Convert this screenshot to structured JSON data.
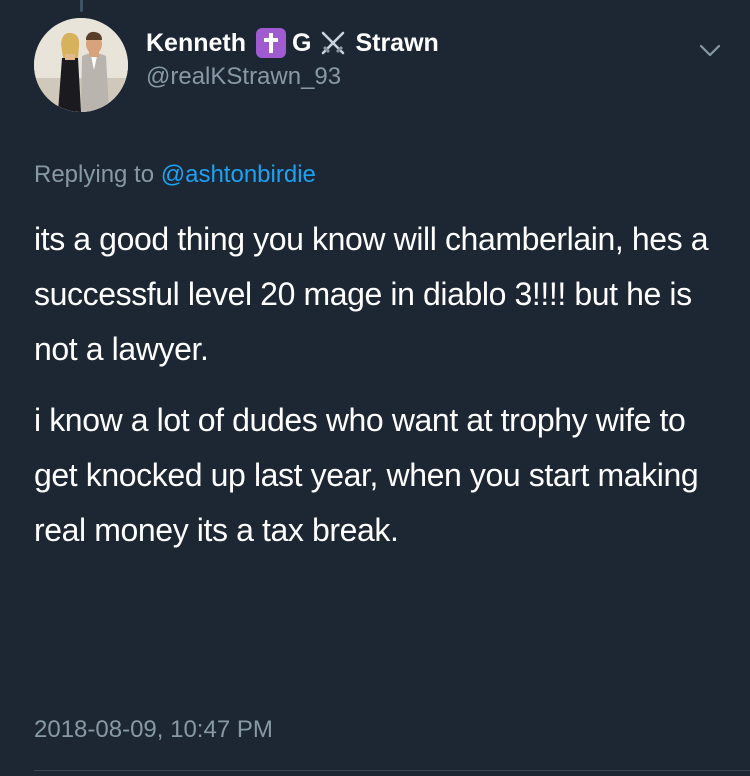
{
  "author": {
    "first_name": "Kenneth",
    "middle": "G",
    "last_name": "Strawn",
    "handle": "@realKStrawn_93"
  },
  "reply": {
    "prefix": "Replying to",
    "mention": "@ashtonbirdie"
  },
  "tweet": {
    "paragraphs": [
      "its a good thing you know will chamberlain, hes a successful level 20 mage in diablo 3!!!! but he is not a lawyer.",
      "i know a lot of dudes who want at trophy wife to get knocked up last year, when you start making real money its a tax break."
    ],
    "timestamp": "2018-08-09, 10:47 PM"
  },
  "icons": {
    "badge1": "latin-cross-icon",
    "badge2": "crossed-swords-icon",
    "menu": "chevron-down-icon"
  },
  "colors": {
    "background": "#1c2733",
    "text": "#ffffff",
    "secondary": "#8899a6",
    "link": "#1da1f2",
    "badge": "#a15bd1"
  }
}
